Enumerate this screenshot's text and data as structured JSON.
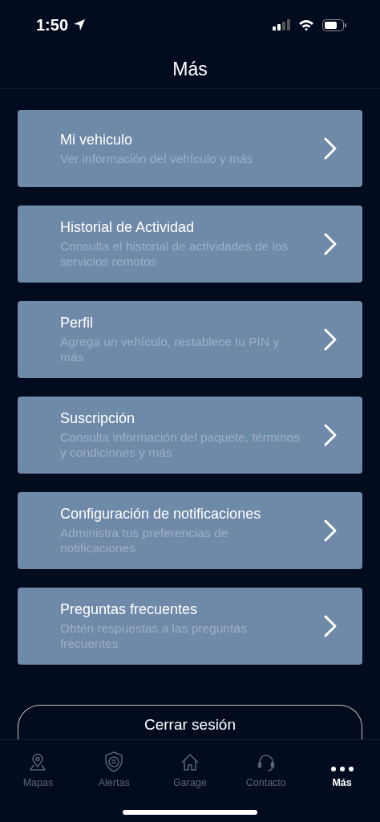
{
  "status_bar": {
    "time": "1:50"
  },
  "header": {
    "title": "Más"
  },
  "menu": [
    {
      "title": "Mi vehiculo",
      "subtitle": "Ver información del vehículo y más"
    },
    {
      "title": "Historial de Actividad",
      "subtitle": "Consulta el historial de actividades de los servicios remotos"
    },
    {
      "title": "Perfil",
      "subtitle": "Agrega un vehículo, restablece tu PIN y más"
    },
    {
      "title": "Suscripción",
      "subtitle": "Consulta información del paquete, términos y condiciones y más"
    },
    {
      "title": "Configuración de notificaciones",
      "subtitle": "Administra tus preferencias de notificaciones"
    },
    {
      "title": "Preguntas frecuentes",
      "subtitle": "Obtén respuestas a las preguntas frecuentes"
    }
  ],
  "logout_button": {
    "label": "Cerrar sesión"
  },
  "tab_bar": [
    {
      "label": "Mapas",
      "kind": "map",
      "selected": false
    },
    {
      "label": "Alertas",
      "kind": "shield",
      "selected": false
    },
    {
      "label": "Garage",
      "kind": "home",
      "selected": false
    },
    {
      "label": "Contacto",
      "kind": "headset",
      "selected": false
    },
    {
      "label": "Más",
      "kind": "more",
      "selected": true
    }
  ]
}
